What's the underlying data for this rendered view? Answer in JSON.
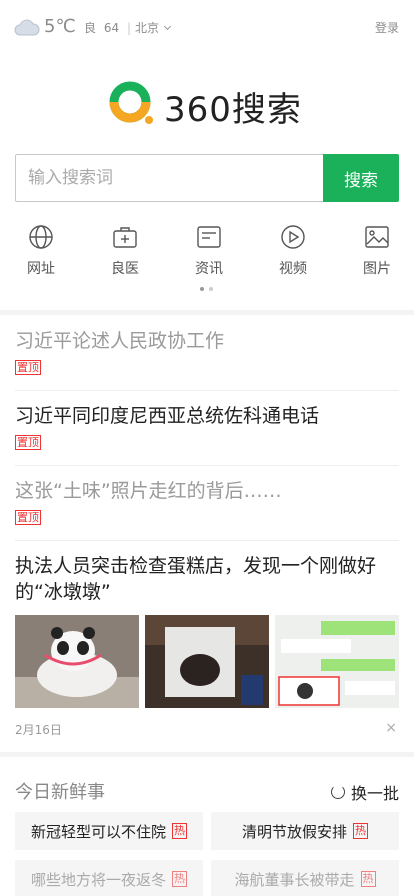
{
  "header": {
    "temperature": "5℃",
    "aqi_label": "良",
    "aqi_value": "64",
    "aqi_separator": "|",
    "city": "北京",
    "login": "登录"
  },
  "logo": {
    "text": "360搜索"
  },
  "search": {
    "placeholder": "输入搜索词",
    "button": "搜索"
  },
  "nav": [
    {
      "label": "网址",
      "icon": "globe-icon"
    },
    {
      "label": "良医",
      "icon": "medical-kit-icon"
    },
    {
      "label": "资讯",
      "icon": "news-icon"
    },
    {
      "label": "视频",
      "icon": "play-icon"
    },
    {
      "label": "图片",
      "icon": "image-icon"
    }
  ],
  "news": [
    {
      "title": "习近平论述人民政协工作",
      "tag": "置顶",
      "read": true
    },
    {
      "title": "习近平同印度尼西亚总统佐科通电话",
      "tag": "置顶",
      "read": false
    },
    {
      "title": "这张“土味”照片走红的背后……",
      "tag": "置顶",
      "read": true
    }
  ],
  "feature": {
    "title": "执法人员突击检查蛋糕店，发现一个刚做好的“冰墩墩”",
    "date": "2月16日",
    "close": "×"
  },
  "fresh": {
    "title": "今日新鲜事",
    "refresh": "换一批",
    "items": [
      {
        "label": "新冠轻型可以不住院",
        "hot": "热"
      },
      {
        "label": "清明节放假安排",
        "hot": "热"
      },
      {
        "label": "哪些地方将一夜返冬",
        "hot": "热"
      },
      {
        "label": "海航董事长被带走",
        "hot": "热"
      }
    ]
  },
  "colors": {
    "accent": "#1ab15a",
    "hot": "#ee3333",
    "logo_green": "#1ab15a",
    "logo_orange": "#f5a623"
  }
}
